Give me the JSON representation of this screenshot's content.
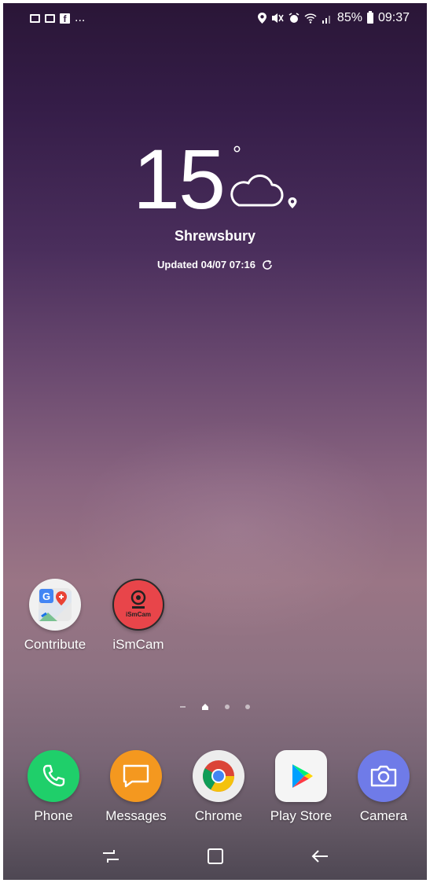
{
  "status_bar": {
    "left_icons": [
      "gallery-icon",
      "email-icon",
      "facebook-icon"
    ],
    "more": "...",
    "battery": "85%",
    "time": "09:37"
  },
  "weather": {
    "temperature": "15",
    "unit": "°",
    "condition_icon": "cloud-icon",
    "location": "Shrewsbury",
    "updated": "Updated 04/07 07:16"
  },
  "home_apps": [
    {
      "label": "Contribute",
      "icon": "google-maps-contribute-icon"
    },
    {
      "label": "iSmCam",
      "icon": "ismcam-icon",
      "icon_text": "iSmCam"
    }
  ],
  "dock": [
    {
      "label": "Phone",
      "icon": "phone-icon",
      "color": "#1fcf6a"
    },
    {
      "label": "Messages",
      "icon": "messages-icon",
      "color": "#f4981f"
    },
    {
      "label": "Chrome",
      "icon": "chrome-icon",
      "color": "#ffffff"
    },
    {
      "label": "Play Store",
      "icon": "play-store-icon",
      "color": "#ffffff"
    },
    {
      "label": "Camera",
      "icon": "camera-icon",
      "color": "#6f7be8"
    }
  ],
  "nav": [
    "recent-apps-icon",
    "home-icon",
    "back-icon"
  ]
}
